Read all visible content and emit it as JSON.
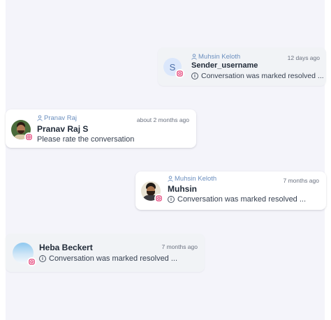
{
  "conversations": [
    {
      "agent": "Muhsin Keloth",
      "time": "12 days ago",
      "avatar_letter": "S",
      "name": "Sender_username",
      "message": "Conversation was marked resolved ..."
    },
    {
      "agent": "Pranav Raj",
      "time": "about 2 months ago",
      "name": "Pranav Raj S",
      "message": "Please rate the conversation"
    },
    {
      "agent": "Muhsin Keloth",
      "time": "7 months ago",
      "name": "Muhsin",
      "message": "Conversation was marked resolved ..."
    },
    {
      "time": "7 months ago",
      "name": "Heba Beckert",
      "message": "Conversation was marked resolved ..."
    }
  ],
  "colors": {
    "panel_bg": "#f4f4fa",
    "agent_text": "#6b8fbf",
    "instagram_badge": "#e1306c"
  }
}
